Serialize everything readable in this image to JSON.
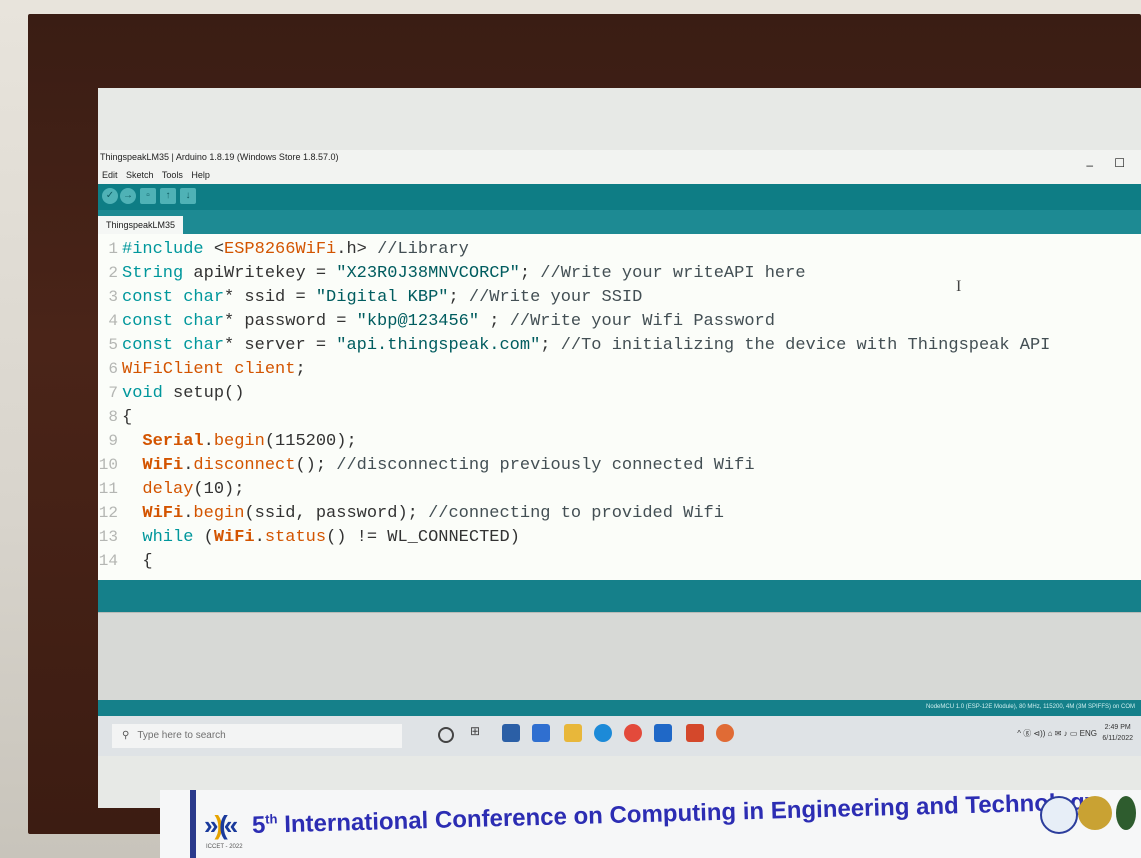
{
  "window": {
    "title": "ThingspeakLM35 | Arduino 1.8.19 (Windows Store 1.8.57.0)",
    "minimize": "–",
    "maximize": "☐"
  },
  "menu": [
    "Edit",
    "Sketch",
    "Tools",
    "Help"
  ],
  "toolbar": {
    "buttons": [
      "verify-icon",
      "upload-icon",
      "new-icon",
      "open-icon",
      "save-icon"
    ]
  },
  "tab": {
    "label": "ThingspeakLM35"
  },
  "code": [
    {
      "n": "1",
      "parts": [
        [
          "#include ",
          "kw"
        ],
        [
          "<",
          "plain"
        ],
        [
          "ESP8266WiFi",
          "fn"
        ],
        [
          ".h> ",
          "plain"
        ],
        [
          "//Library",
          "cm"
        ]
      ]
    },
    {
      "n": "2",
      "parts": [
        [
          "String ",
          "typ"
        ],
        [
          "apiWritekey = ",
          "plain"
        ],
        [
          "\"X23R0J38MNVCORCP\"",
          "str"
        ],
        [
          "; ",
          "plain"
        ],
        [
          "//Write your writeAPI here",
          "cm"
        ]
      ]
    },
    {
      "n": "3",
      "parts": [
        [
          "const char",
          "typ"
        ],
        [
          "* ssid = ",
          "plain"
        ],
        [
          "\"Digital KBP\"",
          "str"
        ],
        [
          "; ",
          "plain"
        ],
        [
          "//Write your SSID",
          "cm"
        ]
      ]
    },
    {
      "n": "4",
      "parts": [
        [
          "const char",
          "typ"
        ],
        [
          "* password = ",
          "plain"
        ],
        [
          "\"kbp@123456\"",
          "str"
        ],
        [
          " ; ",
          "plain"
        ],
        [
          "//Write your Wifi Password",
          "cm"
        ]
      ]
    },
    {
      "n": "5",
      "parts": [
        [
          "const char",
          "typ"
        ],
        [
          "* server = ",
          "plain"
        ],
        [
          "\"api.thingspeak.com\"",
          "str"
        ],
        [
          "; ",
          "plain"
        ],
        [
          "//To initializing the device with Thingspeak API",
          "cm"
        ]
      ]
    },
    {
      "n": "6",
      "parts": [
        [
          "WiFiClient client",
          "fn"
        ],
        [
          ";",
          "plain"
        ]
      ]
    },
    {
      "n": "7",
      "parts": [
        [
          "void ",
          "typ"
        ],
        [
          "setup()",
          "plain"
        ]
      ]
    },
    {
      "n": "8",
      "parts": [
        [
          "{",
          "plain"
        ]
      ]
    },
    {
      "n": "9",
      "parts": [
        [
          "  ",
          "plain"
        ],
        [
          "Serial",
          "cls"
        ],
        [
          ".",
          "plain"
        ],
        [
          "begin",
          "fn"
        ],
        [
          "(115200);",
          "plain"
        ]
      ]
    },
    {
      "n": "10",
      "parts": [
        [
          "  ",
          "plain"
        ],
        [
          "WiFi",
          "cls"
        ],
        [
          ".",
          "plain"
        ],
        [
          "disconnect",
          "fn"
        ],
        [
          "(); ",
          "plain"
        ],
        [
          "//disconnecting previously connected Wifi",
          "cm"
        ]
      ]
    },
    {
      "n": "11",
      "parts": [
        [
          "  ",
          "plain"
        ],
        [
          "delay",
          "fn"
        ],
        [
          "(10);",
          "plain"
        ]
      ]
    },
    {
      "n": "12",
      "parts": [
        [
          "  ",
          "plain"
        ],
        [
          "WiFi",
          "cls"
        ],
        [
          ".",
          "plain"
        ],
        [
          "begin",
          "fn"
        ],
        [
          "(ssid, password); ",
          "plain"
        ],
        [
          "//connecting to provided Wifi",
          "cm"
        ]
      ]
    },
    {
      "n": "13",
      "parts": [
        [
          "  ",
          "plain"
        ],
        [
          "while",
          "kw"
        ],
        [
          " (",
          "plain"
        ],
        [
          "WiFi",
          "cls"
        ],
        [
          ".",
          "plain"
        ],
        [
          "status",
          "fn"
        ],
        [
          "() != WL_CONNECTED)",
          "plain"
        ]
      ]
    },
    {
      "n": "14",
      "parts": [
        [
          "  {",
          "plain"
        ]
      ]
    }
  ],
  "status": {
    "board": "NodeMCU 1.0 (ESP-12E Module), 80 MHz, 115200, 4M (3M SPIFFS) on COM"
  },
  "taskbar": {
    "search_placeholder": "Type here to search",
    "tray": "^ ⓖ ⊲)) ⌂ ✉ ♪ ▭ ENG",
    "time": "2:49 PM",
    "date": "6/11/2022"
  },
  "banner": {
    "text_prefix": "5",
    "sup": "th",
    "text": " International Conference on Computing in Engineering and Technology",
    "small": "ICCET - 2022"
  }
}
